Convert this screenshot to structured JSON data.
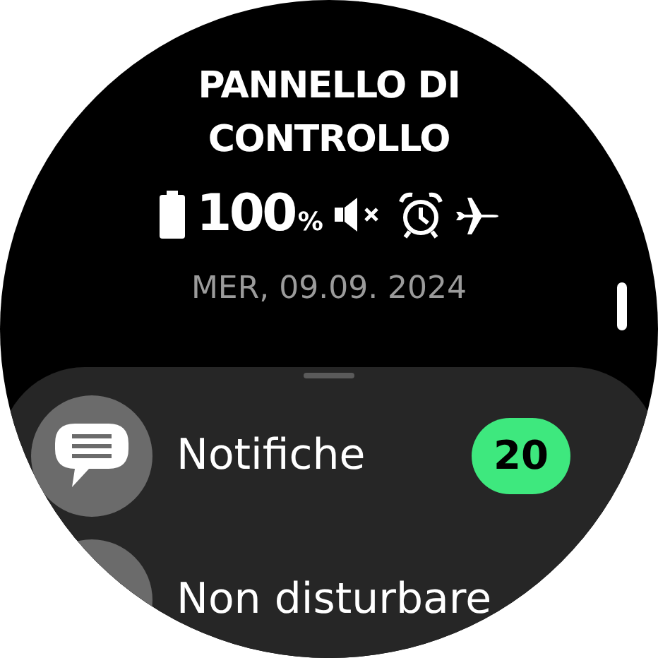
{
  "title": "PANNELLO DI CONTROLLO",
  "status": {
    "battery": "100",
    "unit": "%",
    "icons": [
      {
        "kind": "mute"
      },
      {
        "kind": "alarm"
      },
      {
        "kind": "airplane"
      }
    ]
  },
  "date": "MER, 09.09. 2024",
  "tiles": [
    {
      "kind": "notifications",
      "label": "Notifiche",
      "count": "20"
    },
    {
      "kind": "dnd",
      "label": "Non disturbare"
    }
  ]
}
